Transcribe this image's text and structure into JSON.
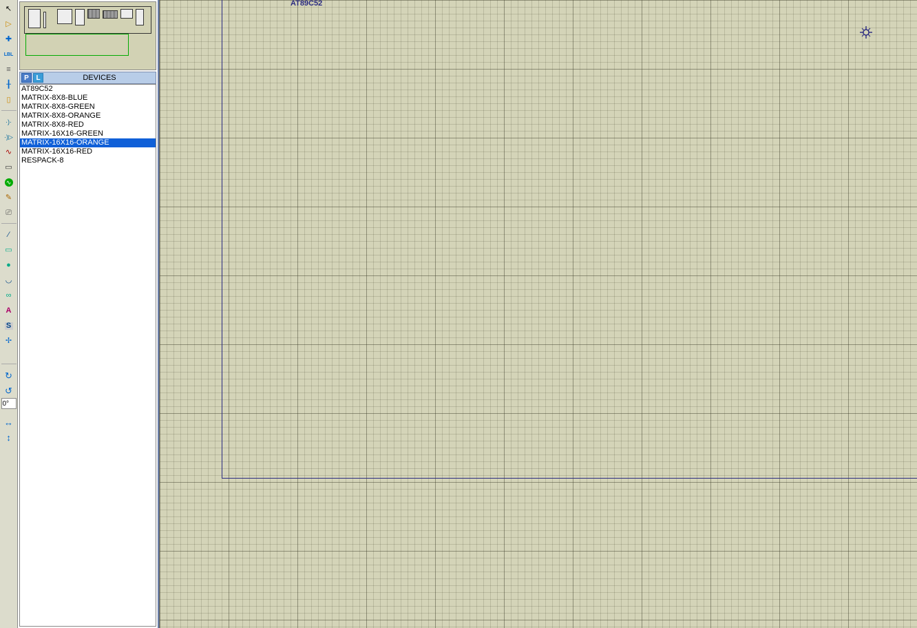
{
  "panel": {
    "title": "DEVICES",
    "p_label": "P",
    "l_label": "L"
  },
  "devices": [
    {
      "name": "AT89C52",
      "selected": false
    },
    {
      "name": "MATRIX-8X8-BLUE",
      "selected": false
    },
    {
      "name": "MATRIX-8X8-GREEN",
      "selected": false
    },
    {
      "name": "MATRIX-8X8-ORANGE",
      "selected": false
    },
    {
      "name": "MATRIX-8X8-RED",
      "selected": false
    },
    {
      "name": "MATRIX-16X16-GREEN",
      "selected": false
    },
    {
      "name": "MATRIX-16X16-ORANGE",
      "selected": true
    },
    {
      "name": "MATRIX-16X16-RED",
      "selected": false
    },
    {
      "name": "RESPACK-8",
      "selected": false
    }
  ],
  "rotate": {
    "value": "0°"
  },
  "canvas": {
    "top_label": "AT89C52"
  },
  "tool_icons": {
    "select": "↖",
    "component": "▷",
    "junction": "✚",
    "label": "LBL",
    "script": "≡",
    "bus": "╂",
    "subcircuit": "▯",
    "terminal": "·)·",
    "pin": "·)▷",
    "graph": "∿",
    "rect_gadget": "▭",
    "generator": "∿",
    "probe": "✎",
    "vinstrument": "⎚",
    "line": "∕",
    "rect": "▭",
    "circle": "●",
    "arc": "◡",
    "path": "∞",
    "text": "A",
    "symbol": "S",
    "origin": "✢",
    "rot_cw": "↻",
    "rot_ccw": "↺",
    "flip_h": "↔",
    "flip_v": "↕"
  },
  "colors": {
    "selection": "#1060d8",
    "sheet_border": "#2a2a80",
    "grid_bg": "#d4d4b8"
  }
}
